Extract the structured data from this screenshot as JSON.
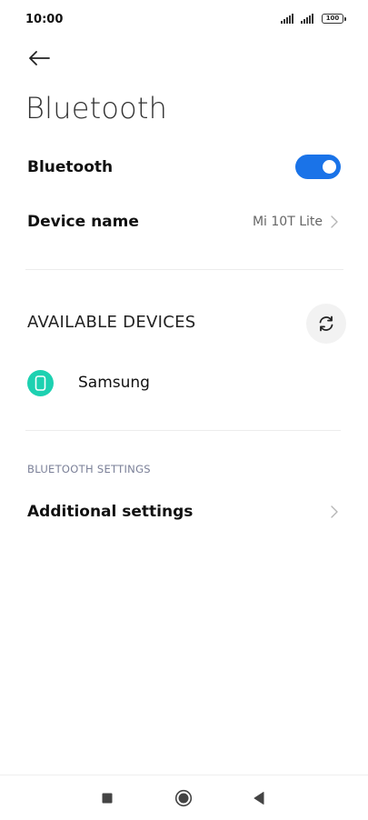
{
  "status_bar": {
    "time": "10:00",
    "battery": "100"
  },
  "header": {
    "back_icon": "arrow-left-icon",
    "title": "Bluetooth"
  },
  "bluetooth_toggle": {
    "label": "Bluetooth",
    "enabled": true,
    "accent_color": "#1a73e8"
  },
  "device_name": {
    "label": "Device name",
    "value": "Mi 10T Lite"
  },
  "available_devices": {
    "title": "AVAILABLE DEVICES",
    "refresh_icon": "refresh-icon",
    "devices": [
      {
        "name": "Samsung",
        "icon": "phone-icon",
        "icon_color": "#1dd1b1"
      }
    ]
  },
  "bluetooth_settings": {
    "label": "BLUETOOTH SETTINGS",
    "items": [
      {
        "label": "Additional settings"
      }
    ]
  },
  "nav_bar": {
    "recents_icon": "square-icon",
    "home_icon": "circle-icon",
    "back_icon": "triangle-back-icon"
  }
}
